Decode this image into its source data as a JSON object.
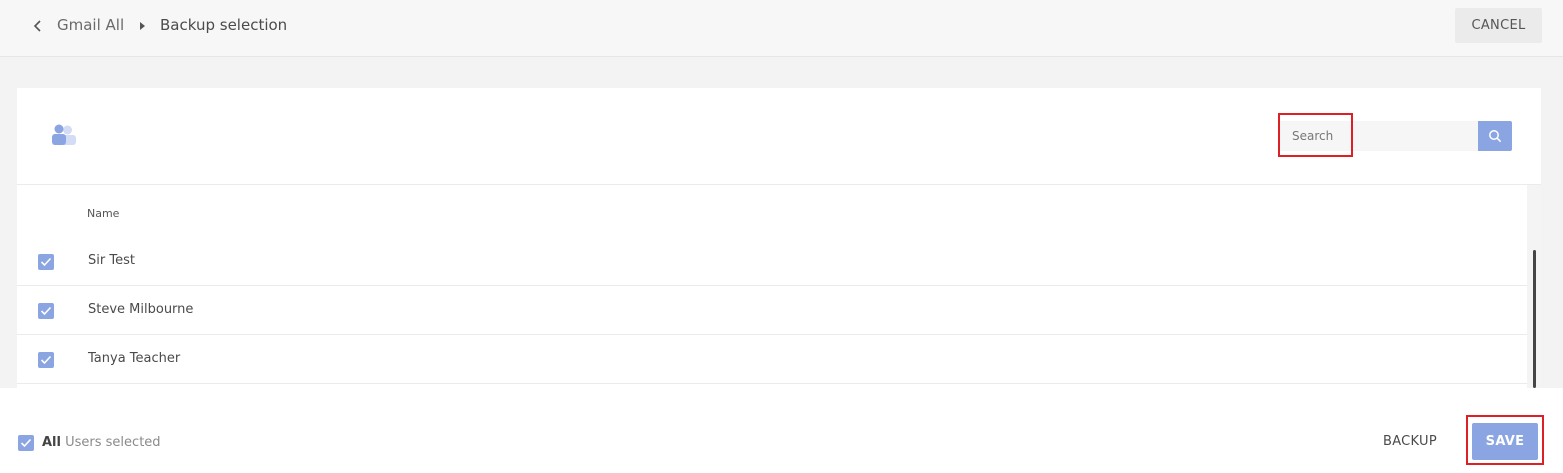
{
  "header": {
    "back_icon": "chevron-left-icon",
    "breadcrumb_parent": "Gmail All",
    "breadcrumb_separator_icon": "caret-right-icon",
    "breadcrumb_current": "Backup selection",
    "cancel_label": "CANCEL"
  },
  "toolbar": {
    "users_icon": "users-icon",
    "search_placeholder": "Search",
    "search_icon": "search-icon"
  },
  "table": {
    "column_header": "Name",
    "rows": [
      {
        "name": "Sir Test",
        "checked": true
      },
      {
        "name": "Steve Milbourne",
        "checked": true
      },
      {
        "name": "Tanya Teacher",
        "checked": true
      }
    ]
  },
  "footer": {
    "select_all_checked": true,
    "selection_strong": "All",
    "selection_text": "Users selected",
    "backup_label": "BACKUP",
    "save_label": "SAVE"
  },
  "colors": {
    "accent": "#8aa5e2",
    "highlight": "#dd1f26"
  }
}
